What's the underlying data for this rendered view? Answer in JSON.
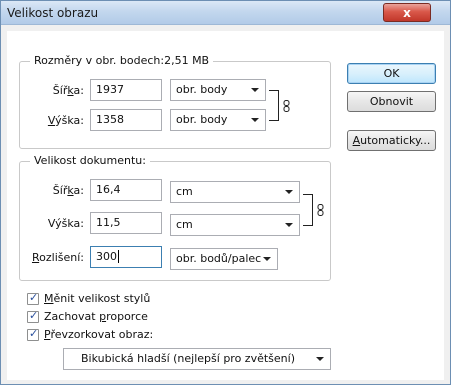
{
  "window": {
    "title": "Velikost obrazu",
    "close_label": "x"
  },
  "pixel_group": {
    "legend": "Rozměry v obr. bodech:2,51 MB",
    "width_label_pre": "Šíř",
    "width_label_u": "k",
    "width_label_post": "a:",
    "height_label_pre": "",
    "height_label_u": "V",
    "height_label_post": "ýška:",
    "width_value": "1937",
    "height_value": "1358",
    "width_unit": "obr. body",
    "height_unit": "obr. body"
  },
  "doc_group": {
    "legend": "Velikost dokumentu:",
    "width_label_pre": "Šíř",
    "width_label_u": "k",
    "width_label_post": "a:",
    "height_label": "Výška:",
    "res_label_pre": "",
    "res_label_u": "R",
    "res_label_post": "ozlišení:",
    "width_value": "16,4",
    "height_value": "11,5",
    "res_value": "300",
    "width_unit": "cm",
    "height_unit": "cm",
    "res_unit": "obr. bodů/palec"
  },
  "buttons": {
    "ok": "OK",
    "reset": "Obnovit",
    "auto_pre": "",
    "auto_u": "A",
    "auto_post": "utomaticky..."
  },
  "options": {
    "scale_styles_pre": "",
    "scale_styles_u": "M",
    "scale_styles_post": "ěnit velikost stylů",
    "constrain_pre": "Zachovat ",
    "constrain_u": "p",
    "constrain_post": "roporce",
    "resample_pre": "",
    "resample_u": "P",
    "resample_post": "řevzorkovat obraz:",
    "resample_method": "Bikubická hladší (nejlepší pro zvětšení)"
  }
}
